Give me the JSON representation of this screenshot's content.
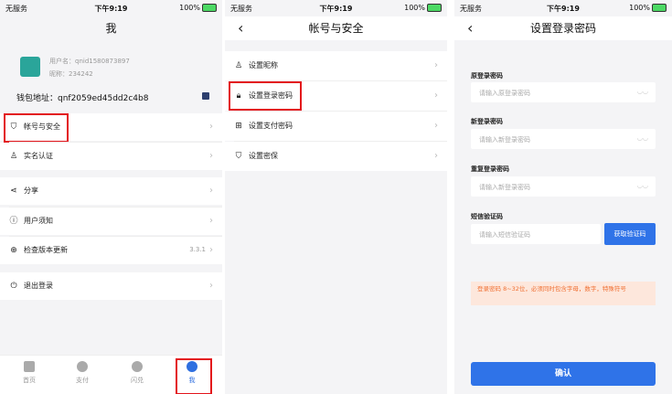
{
  "status": {
    "carrier": "无服务",
    "time": "下午9:19",
    "battery": "100%"
  },
  "screen1": {
    "title": "我",
    "user_label": "用户名：",
    "username": "qnid1580873897",
    "nick_label": "昵称：",
    "nickname": "234242",
    "wallet": "钱包地址：qnf2059ed45dd2c4b8",
    "menu": [
      {
        "label": "帐号与安全",
        "icon": "shield-icon"
      },
      {
        "label": "实名认证",
        "icon": "person-icon"
      },
      {
        "label": "分享",
        "icon": "share-icon"
      },
      {
        "label": "用户须知",
        "icon": "info-icon"
      },
      {
        "label": "检查版本更新",
        "icon": "update-icon",
        "version": "3.3.1"
      },
      {
        "label": "退出登录",
        "icon": "power-icon"
      }
    ],
    "tabs": [
      {
        "label": "首页",
        "icon": "home-icon"
      },
      {
        "label": "支付",
        "icon": "pay-icon"
      },
      {
        "label": "闪兑",
        "icon": "exchange-icon"
      },
      {
        "label": "我",
        "icon": "profile-icon",
        "active": true
      }
    ]
  },
  "screen2": {
    "title": "帐号与安全",
    "items": [
      {
        "label": "设置昵称",
        "icon": "person-icon"
      },
      {
        "label": "设置登录密码",
        "icon": "lock-icon"
      },
      {
        "label": "设置支付密码",
        "icon": "pay-lock-icon"
      },
      {
        "label": "设置密保",
        "icon": "shield-icon"
      }
    ]
  },
  "screen3": {
    "title": "设置登录密码",
    "fields": [
      {
        "label": "原登录密码",
        "placeholder": "请输入原登录密码"
      },
      {
        "label": "新登录密码",
        "placeholder": "请输入新登录密码"
      },
      {
        "label": "重复登录密码",
        "placeholder": "请输入新登录密码"
      }
    ],
    "sms_label": "短信验证码",
    "sms_placeholder": "请输入短信验证码",
    "sms_button": "获取验证码",
    "notice": "登录密码 8~32位，必须同时包含字母，数字，特殊符号",
    "confirm": "确认"
  },
  "colors": {
    "accent": "#2f73e8",
    "highlight": "#e3141b",
    "notice_bg": "#fde7dc",
    "notice_text": "#f07033"
  }
}
